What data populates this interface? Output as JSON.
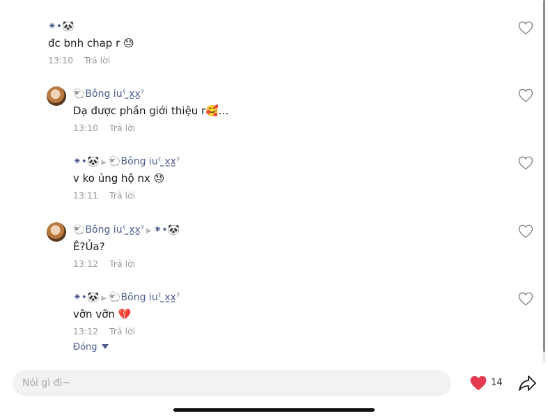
{
  "comments": [
    {
      "author_prefix": "⁕•🐼",
      "author": "",
      "target": "",
      "text": "đc bnh chap r 😓",
      "time": "13:10",
      "reply_label": "Trả lời",
      "has_avatar": false
    },
    {
      "author_prefix": "",
      "author": "🐑Bông iuˁ ̫x̫x̫ˀ",
      "target": "",
      "text": "Dạ được phần giới thiệu r🥰...",
      "time": "13:10",
      "reply_label": "Trả lời",
      "has_avatar": true
    },
    {
      "author_prefix": "⁕•🐼",
      "author": "",
      "target": "🐑Bông iuˁ ̫x̫x̫ˀ",
      "text": "v ko ủng hộ nx 😓",
      "time": "13:11",
      "reply_label": "Trả lời",
      "has_avatar": false
    },
    {
      "author_prefix": "",
      "author": "🐑Bông iuˁ ̫x̫x̫ˀ",
      "target": "⁕•🐼",
      "text": "Ê?Ủa?",
      "time": "13:12",
      "reply_label": "Trả lời",
      "has_avatar": true
    },
    {
      "author_prefix": "⁕•🐼",
      "author": "",
      "target": "🐑Bông iuˁ ̫x̫x̫ˀ",
      "text": "vỡn vỡn 💔",
      "time": "13:12",
      "reply_label": "Trả lời",
      "has_avatar": false
    }
  ],
  "collapse_label": "Đóng",
  "composer": {
    "placeholder": "Nói gì đi~",
    "like_count": "14"
  },
  "colors": {
    "author": "#4b5d8c",
    "heart_filled": "#e53950",
    "meta": "#9a9a9a"
  },
  "icons": {
    "comment_like": "heart-outline-icon",
    "post_like": "heart-filled-icon",
    "share": "share-arrow-icon"
  }
}
